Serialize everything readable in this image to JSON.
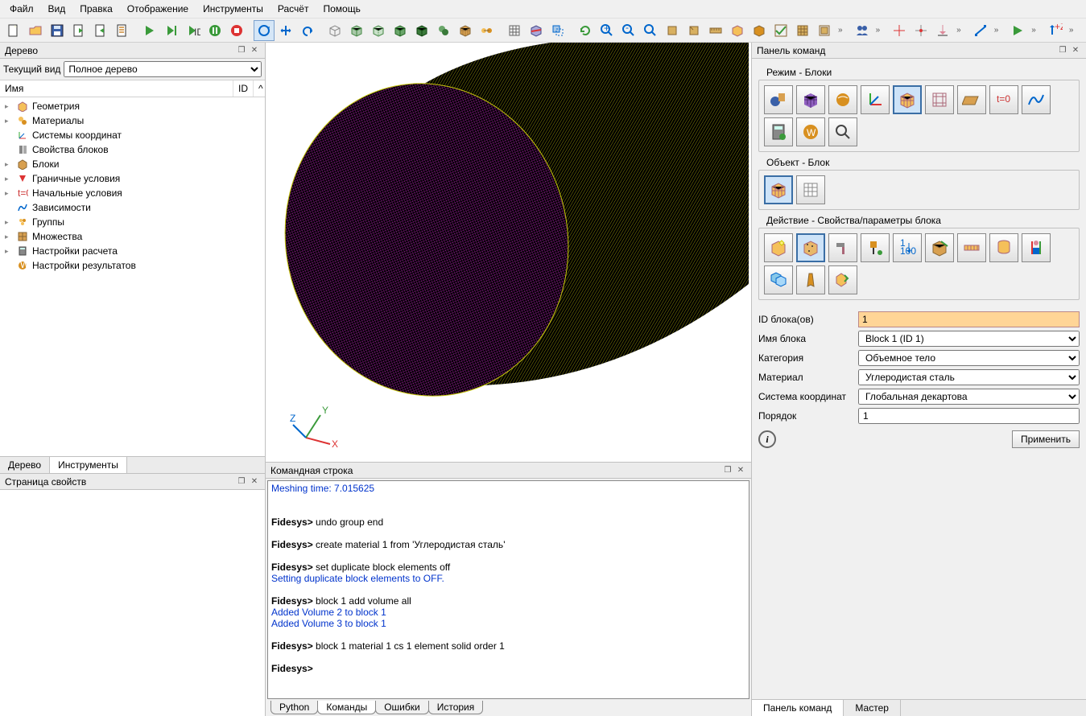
{
  "menu": {
    "items": [
      "Файл",
      "Вид",
      "Правка",
      "Отображение",
      "Инструменты",
      "Расчёт",
      "Помощь"
    ]
  },
  "panels": {
    "tree": "Дерево",
    "props": "Страница свойств",
    "cmd": "Командная строка",
    "commands": "Панель команд"
  },
  "tree": {
    "view_label": "Текущий вид",
    "view_select": "Полное дерево",
    "col_name": "Имя",
    "col_id": "ID",
    "items": [
      "Геометрия",
      "Материалы",
      "Системы координат",
      "Свойства блоков",
      "Блоки",
      "Граничные условия",
      "Начальные условия",
      "Зависимости",
      "Группы",
      "Множества",
      "Настройки расчета",
      "Настройки результатов"
    ],
    "tabs": {
      "tree": "Дерево",
      "tools": "Инструменты"
    }
  },
  "cmd": {
    "lines": [
      {
        "cls": "blue",
        "txt": "Meshing time: 7.015625"
      },
      {
        "cls": "",
        "txt": ""
      },
      {
        "cls": "",
        "txt": ""
      },
      {
        "cls": "prompt",
        "txt": "Fidesys> undo group end"
      },
      {
        "cls": "",
        "txt": ""
      },
      {
        "cls": "prompt",
        "txt": "Fidesys> create material 1 from 'Углеродистая сталь'"
      },
      {
        "cls": "",
        "txt": ""
      },
      {
        "cls": "prompt",
        "txt": "Fidesys> set duplicate block elements off"
      },
      {
        "cls": "blue",
        "txt": "Setting duplicate block elements to OFF."
      },
      {
        "cls": "",
        "txt": ""
      },
      {
        "cls": "prompt",
        "txt": "Fidesys> block 1 add volume all"
      },
      {
        "cls": "blue",
        "txt": "Added Volume 2 to block 1"
      },
      {
        "cls": "blue",
        "txt": "Added Volume 3 to block 1"
      },
      {
        "cls": "",
        "txt": ""
      },
      {
        "cls": "prompt",
        "txt": "Fidesys> block 1 material 1 cs 1 element solid order 1"
      },
      {
        "cls": "",
        "txt": ""
      },
      {
        "cls": "prompt",
        "txt": "Fidesys>"
      }
    ],
    "tabs": [
      "Python",
      "Команды",
      "Ошибки",
      "История"
    ],
    "active_tab": "Команды"
  },
  "cp": {
    "mode_label": "Режим - Блоки",
    "object_label": "Объект - Блок",
    "action_label": "Действие - Свойства/параметры блока",
    "form": {
      "id_label": "ID блока(ов)",
      "id_value": "1",
      "name_label": "Имя блока",
      "name_value": "Block 1 (ID 1)",
      "cat_label": "Категория",
      "cat_value": "Объемное тело",
      "mat_label": "Материал",
      "mat_value": "Углеродистая сталь",
      "cs_label": "Система координат",
      "cs_value": "Глобальная декартова",
      "order_label": "Порядок",
      "order_value": "1"
    },
    "apply": "Применить"
  },
  "right_tabs": {
    "panel": "Панель команд",
    "master": "Мастер"
  }
}
